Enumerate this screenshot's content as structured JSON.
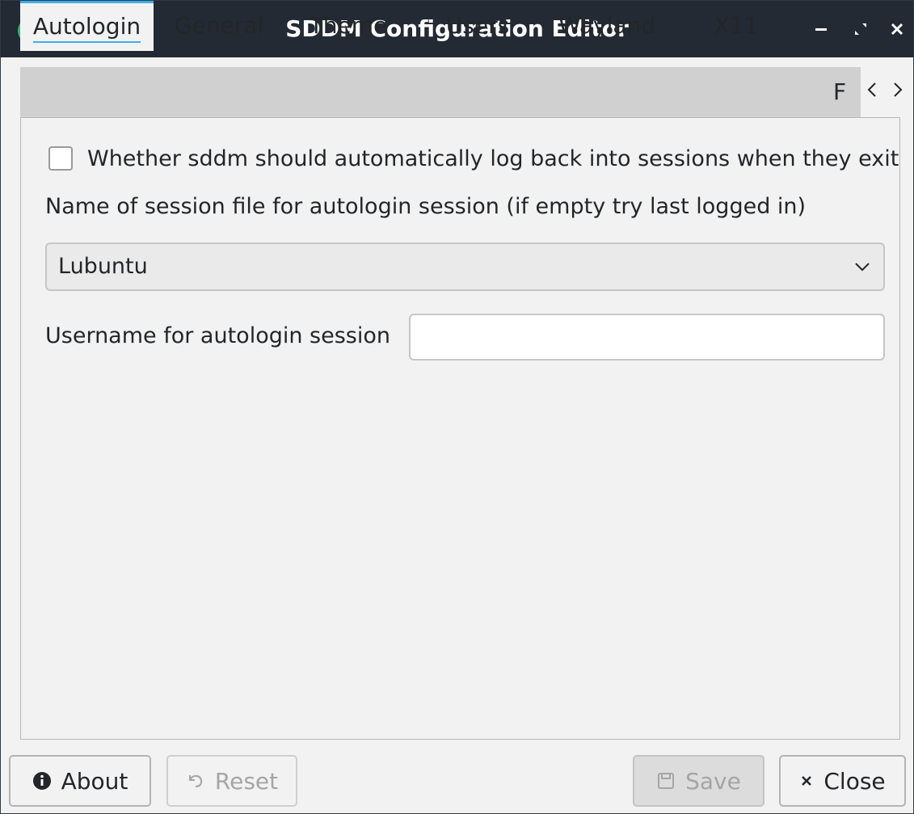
{
  "window": {
    "title": "SDDM Configuration Editor"
  },
  "icons": {
    "app": "sddm-app-icon",
    "minimize": "minimize-icon",
    "maximize": "maximize-icon",
    "close": "close-icon"
  },
  "tabs": [
    {
      "label": "Autologin",
      "active": true
    },
    {
      "label": "General",
      "active": false
    },
    {
      "label": "Theme",
      "active": false
    },
    {
      "label": "Users",
      "active": false
    },
    {
      "label": "Wayland",
      "active": false
    },
    {
      "label": "X11",
      "active": false
    },
    {
      "label": "F",
      "active": false
    }
  ],
  "autologin": {
    "relogin_label": "Whether sddm should automatically log back into sessions when they exit",
    "relogin_checked": false,
    "session_label": "Name of session file for autologin session (if empty try last logged in)",
    "session_value": "Lubuntu",
    "user_label": "Username for autologin session",
    "user_value": ""
  },
  "buttons": {
    "about": "About",
    "reset": "Reset",
    "save": "Save",
    "close": "Close"
  },
  "colors": {
    "titlebar": "#232a33",
    "accent": "#3daee9",
    "app_icon": "#2bb673"
  }
}
